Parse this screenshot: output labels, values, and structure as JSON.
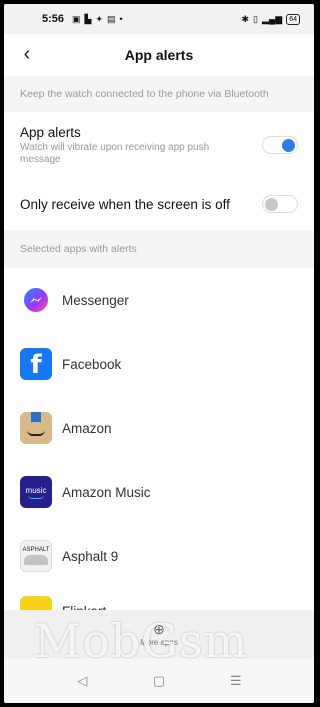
{
  "status_bar": {
    "time": "5:56",
    "left_icons": [
      "gallery-icon",
      "flipboard-icon",
      "twitter-icon",
      "photos-icon",
      "dot-icon"
    ],
    "right_icons": [
      "bluetooth-icon",
      "vibrate-icon",
      "signal-icon"
    ],
    "battery": "64"
  },
  "header": {
    "title": "App alerts",
    "back_icon": "chevron-left-icon"
  },
  "info_label": "Keep the watch connected to the phone via Bluetooth",
  "settings": {
    "app_alerts": {
      "name": "App alerts",
      "description": "Watch will vibrate upon receiving app push message",
      "enabled": true
    },
    "screen_off_only": {
      "name": "Only receive when the screen is off",
      "enabled": false
    }
  },
  "apps_label": "Selected apps with alerts",
  "apps": [
    {
      "name": "Messenger",
      "icon": "messenger-icon"
    },
    {
      "name": "Facebook",
      "icon": "facebook-icon"
    },
    {
      "name": "Amazon",
      "icon": "amazon-icon"
    },
    {
      "name": "Amazon Music",
      "icon": "amazon-music-icon"
    },
    {
      "name": "Asphalt 9",
      "icon": "asphalt-icon"
    },
    {
      "name": "Flipkart",
      "icon": "flipkart-icon"
    }
  ],
  "icon_text": {
    "facebook": "f",
    "amazon_music": "music",
    "asphalt": "ASPHALT"
  },
  "bottom_panel": {
    "label": "More apps",
    "icon": "add-app-icon"
  },
  "navbar": {
    "back": "◁",
    "home": "▢",
    "menu": "☰"
  },
  "watermark": "MobGsm",
  "colors": {
    "accent": "#2f7fe0",
    "section_bg": "#f5f5f5",
    "muted_text": "#9a9a9a"
  }
}
